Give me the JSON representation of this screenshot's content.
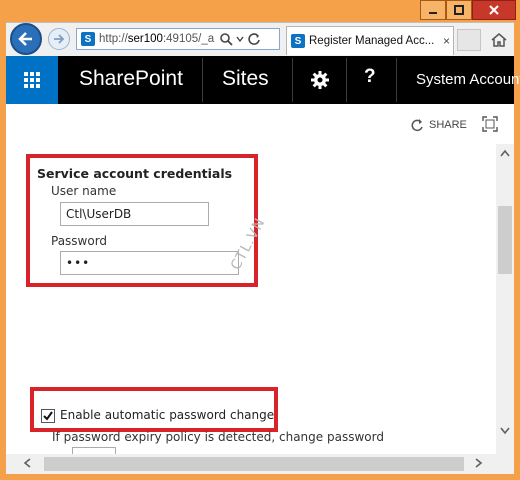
{
  "browser": {
    "address": {
      "url_prefix": "http://",
      "url_host": "ser100",
      "url_rest": ":49105/_a",
      "site_badge": "S"
    },
    "tab": {
      "badge": "S",
      "title": "Register Managed Acc...",
      "close_glyph": "×"
    }
  },
  "suitebar": {
    "brand": "SharePoint",
    "sites": "Sites",
    "help": "?",
    "account": "System Account"
  },
  "page": {
    "share_label": "SHARE",
    "section_title": "Service account credentials",
    "username_label": "User name",
    "username_value": "Ctl\\UserDB",
    "password_label": "Password",
    "password_value": "•••",
    "auto_password_label": "Enable automatic password change",
    "auto_password_checked": true,
    "expiry_desc": "If password expiry policy is detected, change password"
  },
  "watermark": "CTL.VN",
  "colors": {
    "frame": "#f5a14a",
    "suitebar": "#000000",
    "launcher": "#0072c6",
    "highlight": "#d8232a"
  }
}
